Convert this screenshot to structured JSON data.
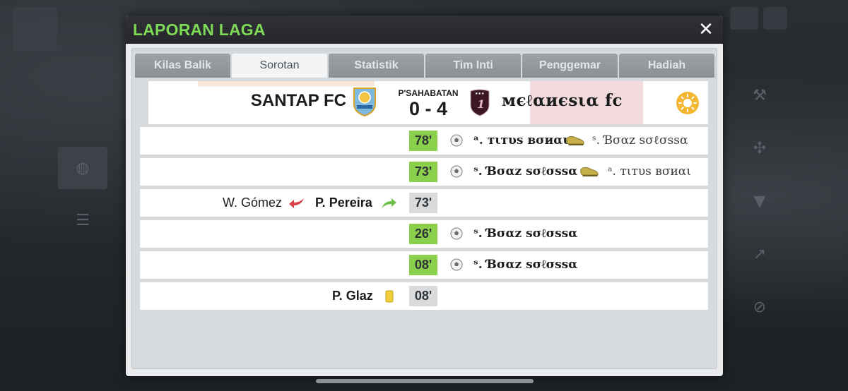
{
  "modal": {
    "title": "LAPORAN LAGA",
    "close_symbol": "✕"
  },
  "tabs": [
    {
      "label": "Kilas Balik",
      "active": false
    },
    {
      "label": "Sorotan",
      "active": true
    },
    {
      "label": "Statistik",
      "active": false
    },
    {
      "label": "Tim Inti",
      "active": false
    },
    {
      "label": "Penggemar",
      "active": false
    },
    {
      "label": "Hadiah",
      "active": false
    }
  ],
  "match": {
    "home_team": "SANTAP FC",
    "away_team": "мєℓαиєѕια fc",
    "competition": "P'SAHABATAN",
    "score": "0 - 4",
    "weather": "sun-icon",
    "away_crest_number": "1"
  },
  "events": [
    {
      "minute": "78'",
      "type": "goal",
      "scorer": "ᵃ. тιтυѕ вσиαι",
      "assist_icon": "boot-icon",
      "assister": "ˢ. Ɓσαz ѕσℓσѕѕα"
    },
    {
      "minute": "73'",
      "type": "goal",
      "scorer": "ˢ. Ɓσαz ѕσℓσѕѕα",
      "assist_icon": "boot-icon",
      "assister": "ᵃ. тιтυѕ вσиαι"
    },
    {
      "minute": "73'",
      "type": "substitution",
      "player_out": "W. Gómez",
      "player_in": "P. Pereira"
    },
    {
      "minute": "26'",
      "type": "goal",
      "scorer": "ˢ. Ɓσαz ѕσℓσѕѕα"
    },
    {
      "minute": "08'",
      "type": "goal",
      "scorer": "ˢ. Ɓσαz ѕσℓσѕѕα"
    },
    {
      "minute": "08'",
      "type": "yellow-card",
      "player": "P. Glaz"
    }
  ],
  "colors": {
    "title_green": "#7ed957",
    "goal_minute_bg": "#8bd04c",
    "other_minute_bg": "#d8dadc",
    "sub_out_red": "#d8424a",
    "sub_in_green": "#6cc14a",
    "yellow_card": "#f1cf3a"
  }
}
